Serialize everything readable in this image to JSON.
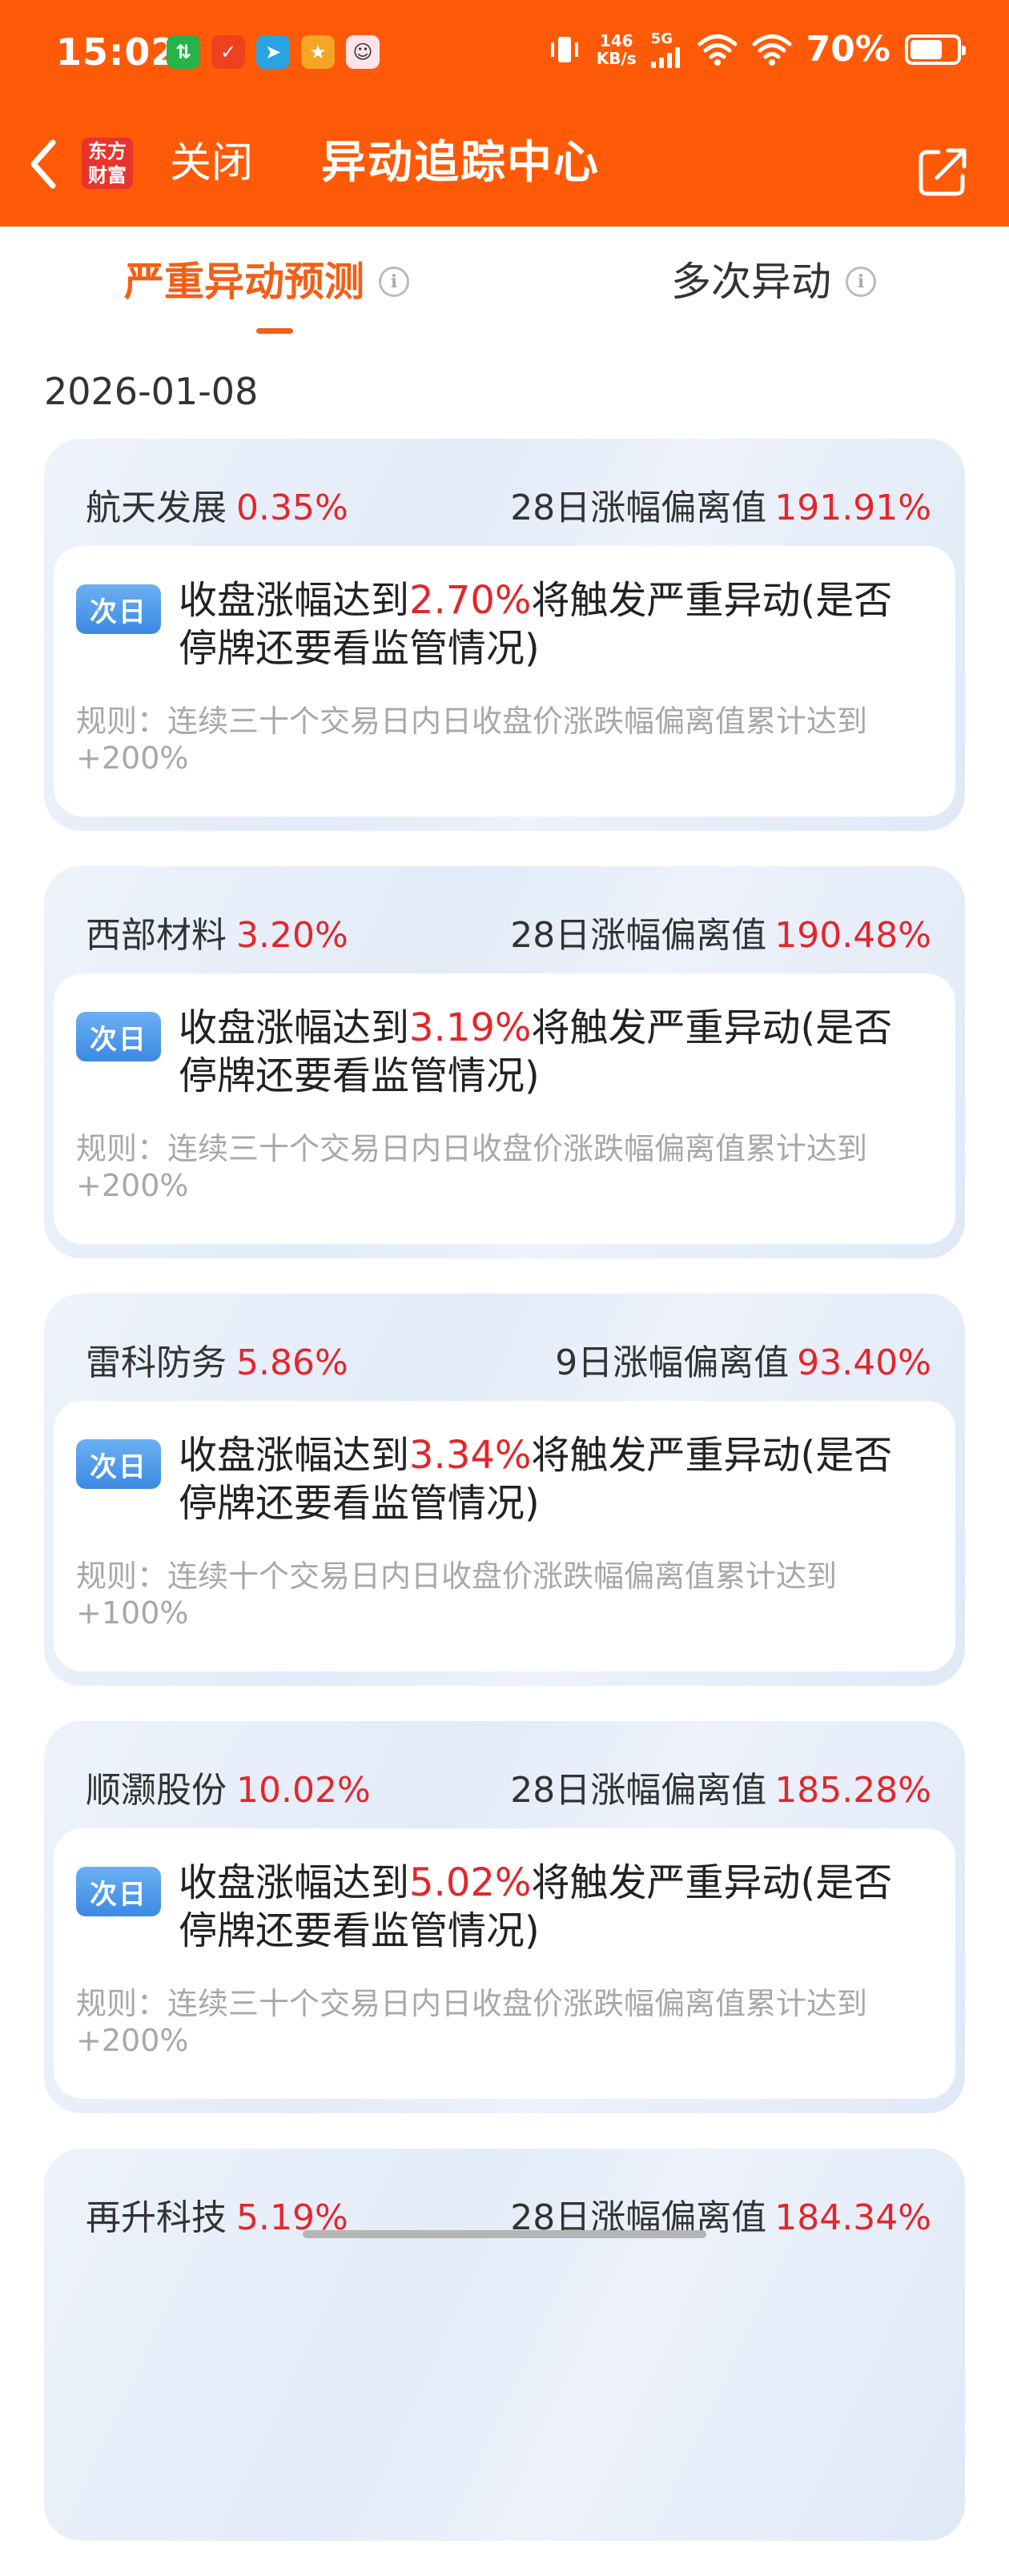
{
  "status_bar": {
    "time": "15:02",
    "net_speed_value": "146",
    "net_speed_unit": "KB/s",
    "network": "5G",
    "battery_percent": "70%",
    "battery_level": 0.7
  },
  "nav": {
    "brand_logo_text": "东方财富",
    "close_label": "关闭",
    "title": "异动追踪中心"
  },
  "tabs": [
    {
      "label": "严重异动预测",
      "active": true
    },
    {
      "label": "多次异动",
      "active": false
    }
  ],
  "date": "2026-01-08",
  "cards": [
    {
      "name": "航天发展",
      "change": "0.35%",
      "deviation_label": "28日涨幅偏离值",
      "deviation_value": "191.91%",
      "badge": "次日",
      "trigger_prefix": "收盘涨幅达到",
      "trigger_pct": "2.70%",
      "trigger_suffix": "将触发严重异动(是否停牌还要看监管情况)",
      "rule": "规则：连续三十个交易日内日收盘价涨跌幅偏离值累计达到+200%"
    },
    {
      "name": "西部材料",
      "change": "3.20%",
      "deviation_label": "28日涨幅偏离值",
      "deviation_value": "190.48%",
      "badge": "次日",
      "trigger_prefix": "收盘涨幅达到",
      "trigger_pct": "3.19%",
      "trigger_suffix": "将触发严重异动(是否停牌还要看监管情况)",
      "rule": "规则：连续三十个交易日内日收盘价涨跌幅偏离值累计达到+200%"
    },
    {
      "name": "雷科防务",
      "change": "5.86%",
      "deviation_label": "9日涨幅偏离值",
      "deviation_value": "93.40%",
      "badge": "次日",
      "trigger_prefix": "收盘涨幅达到",
      "trigger_pct": "3.34%",
      "trigger_suffix": "将触发严重异动(是否停牌还要看监管情况)",
      "rule": "规则：连续十个交易日内日收盘价涨跌幅偏离值累计达到+100%"
    },
    {
      "name": "顺灏股份",
      "change": "10.02%",
      "deviation_label": "28日涨幅偏离值",
      "deviation_value": "185.28%",
      "badge": "次日",
      "trigger_prefix": "收盘涨幅达到",
      "trigger_pct": "5.02%",
      "trigger_suffix": "将触发严重异动(是否停牌还要看监管情况)",
      "rule": "规则：连续三十个交易日内日收盘价涨跌幅偏离值累计达到+200%"
    },
    {
      "name": "再升科技",
      "change": "5.19%",
      "deviation_label": "28日涨幅偏离值",
      "deviation_value": "184.34%"
    }
  ],
  "colors": {
    "header_bg": "#fe5a07",
    "accent": "#f06019",
    "up_red": "#e4262b",
    "badge_blue": "#3c89e3",
    "card_bg": "#e8eff9"
  }
}
